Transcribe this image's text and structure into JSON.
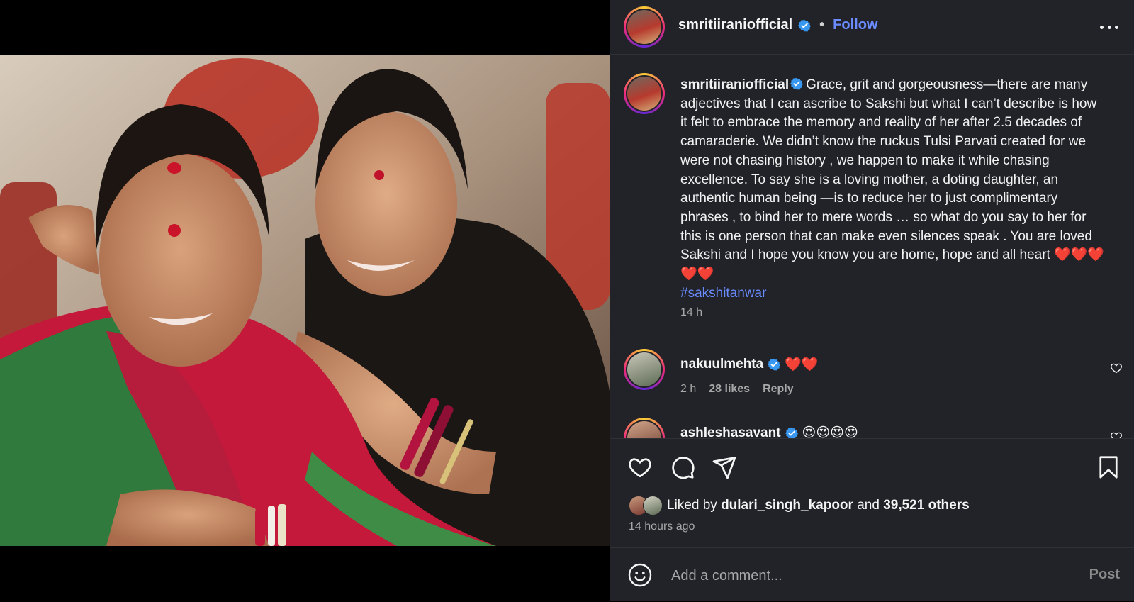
{
  "post": {
    "username": "smritiiraniofficial",
    "follow_label": "Follow",
    "separator": "•",
    "more_icon": "more-horizontal-icon",
    "caption": "Grace, grit and gorgeousness—there are many adjectives that I can ascribe to Sakshi but what I can’t describe is how it felt to embrace the memory and reality of her after 2.5 decades of camaraderie. We didn’t know the ruckus Tulsi Parvati created for we were not chasing history , we happen to make it while chasing excellence. To say she is a loving mother, a doting daughter, an authentic human being —is to reduce her to just complimentary phrases , to bind her to mere words … so what do you say to her for this is one person that can make even silences speak . You are loved Sakshi and I hope you know you are home, hope and all heart ❤️❤️❤️❤️❤️",
    "hashtag": "#sakshitanwar",
    "caption_time": "14 h"
  },
  "comments": [
    {
      "username": "nakuulmehta",
      "text": "❤️❤️",
      "time": "2 h",
      "likes": "28 likes",
      "reply_label": "Reply"
    },
    {
      "username": "ashleshasavant",
      "text": "😍😍😍😍"
    }
  ],
  "actions": {
    "like_icon": "heart-icon",
    "comment_icon": "comment-bubble-icon",
    "share_icon": "paper-plane-icon",
    "save_icon": "bookmark-icon"
  },
  "likes": {
    "prefix": "Liked by",
    "top_liker": "dulari_singh_kapoor",
    "and_label": "and",
    "others": "39,521 others"
  },
  "post_time": "14 hours ago",
  "comment_box": {
    "placeholder": "Add a comment...",
    "post_label": "Post",
    "emoji_icon": "emoji-smile-icon"
  },
  "colors": {
    "panel_bg": "#212328",
    "accent_link": "#6a8cff",
    "verified_badge": "#3897f0",
    "muted_text": "#a8a8a8"
  }
}
